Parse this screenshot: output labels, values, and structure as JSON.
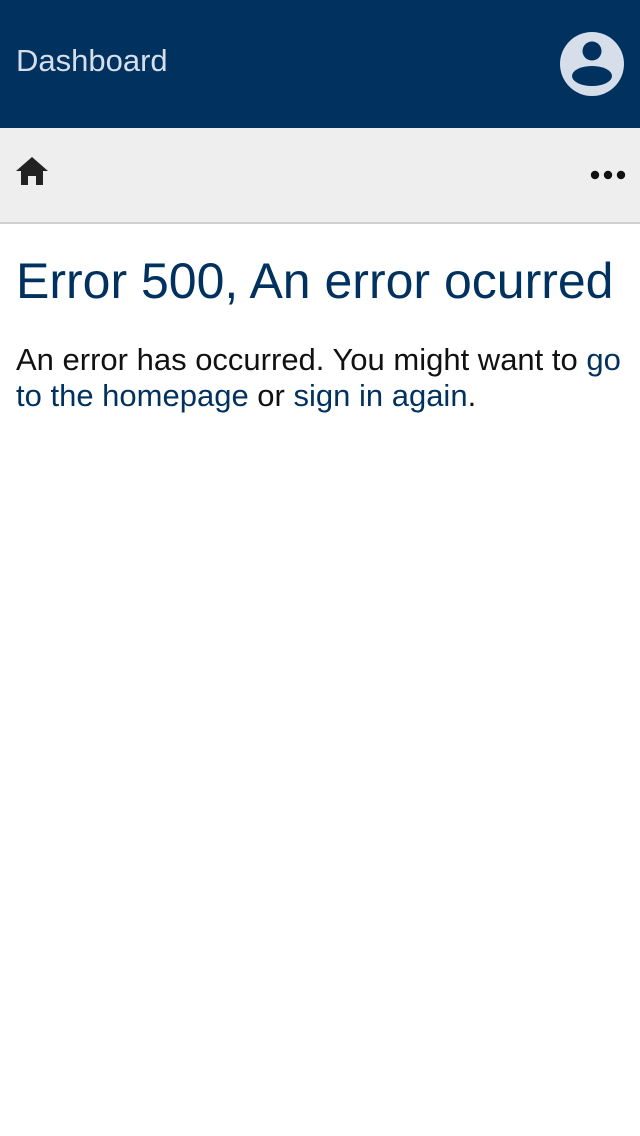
{
  "header": {
    "title": "Dashboard",
    "avatar_icon": "account-circle-icon",
    "background_color": "#00315f"
  },
  "toolbar": {
    "home_icon": "home-icon",
    "more_icon": "more-horizontal-icon"
  },
  "main": {
    "title": "Error 500, An error ocurred",
    "message_prefix": "An error has occurred. You might want to ",
    "homepage_link": "go to the homepage",
    "connector": " or ",
    "signin_link": "sign in again",
    "message_suffix": "."
  }
}
